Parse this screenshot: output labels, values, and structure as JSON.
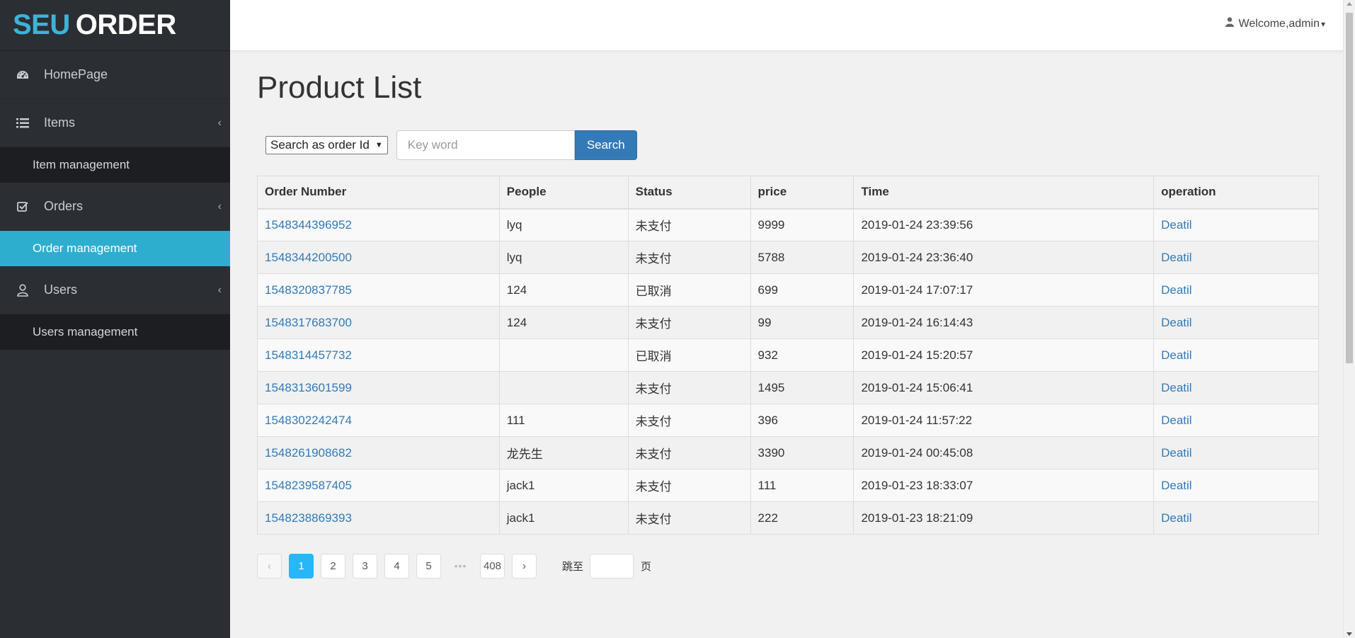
{
  "brand": {
    "part1": "SEU",
    "part2": "ORDER"
  },
  "sidebar": {
    "items": [
      {
        "label": "HomePage",
        "icon": "dashboard-icon"
      },
      {
        "label": "Items",
        "icon": "list-icon",
        "sub": "Item management"
      },
      {
        "label": "Orders",
        "icon": "checkbox-icon",
        "sub": "Order management"
      },
      {
        "label": "Users",
        "icon": "user-icon",
        "sub": "Users management"
      }
    ],
    "active_sub": "Order management",
    "chevron": "‹"
  },
  "header": {
    "welcome": "Welcome,admin",
    "caret": "▾"
  },
  "main": {
    "title": "Product List",
    "search": {
      "select_value": "Search as order Id",
      "placeholder": "Key word",
      "button": "Search"
    },
    "table": {
      "headers": [
        "Order Number",
        "People",
        "Status",
        "price",
        "Time",
        "operation"
      ],
      "rows": [
        [
          "1548344396952",
          "lyq",
          "未支付",
          "9999",
          "2019-01-24 23:39:56",
          "Deatil"
        ],
        [
          "1548344200500",
          "lyq",
          "未支付",
          "5788",
          "2019-01-24 23:36:40",
          "Deatil"
        ],
        [
          "1548320837785",
          "124",
          "已取消",
          "699",
          "2019-01-24 17:07:17",
          "Deatil"
        ],
        [
          "1548317683700",
          "124",
          "未支付",
          "99",
          "2019-01-24 16:14:43",
          "Deatil"
        ],
        [
          "1548314457732",
          "",
          "已取消",
          "932",
          "2019-01-24 15:20:57",
          "Deatil"
        ],
        [
          "1548313601599",
          "",
          "未支付",
          "1495",
          "2019-01-24 15:06:41",
          "Deatil"
        ],
        [
          "1548302242474",
          "111",
          "未支付",
          "396",
          "2019-01-24 11:57:22",
          "Deatil"
        ],
        [
          "1548261908682",
          "龙先生",
          "未支付",
          "3390",
          "2019-01-24 00:45:08",
          "Deatil"
        ],
        [
          "1548239587405",
          "jack1",
          "未支付",
          "111",
          "2019-01-23 18:33:07",
          "Deatil"
        ],
        [
          "1548238869393",
          "jack1",
          "未支付",
          "222",
          "2019-01-23 18:21:09",
          "Deatil"
        ]
      ]
    },
    "pagination": {
      "prev": "‹",
      "pages": [
        "1",
        "2",
        "3",
        "4",
        "5"
      ],
      "current": "1",
      "ellipsis": "•••",
      "last": "408",
      "next": "›",
      "jump_label": "跳至",
      "jump_unit": "页"
    }
  },
  "colors": {
    "accent": "#2eaecf",
    "sidebar_bg": "#2b2e33",
    "link": "#337ab7",
    "page_active": "#29b6f6"
  }
}
